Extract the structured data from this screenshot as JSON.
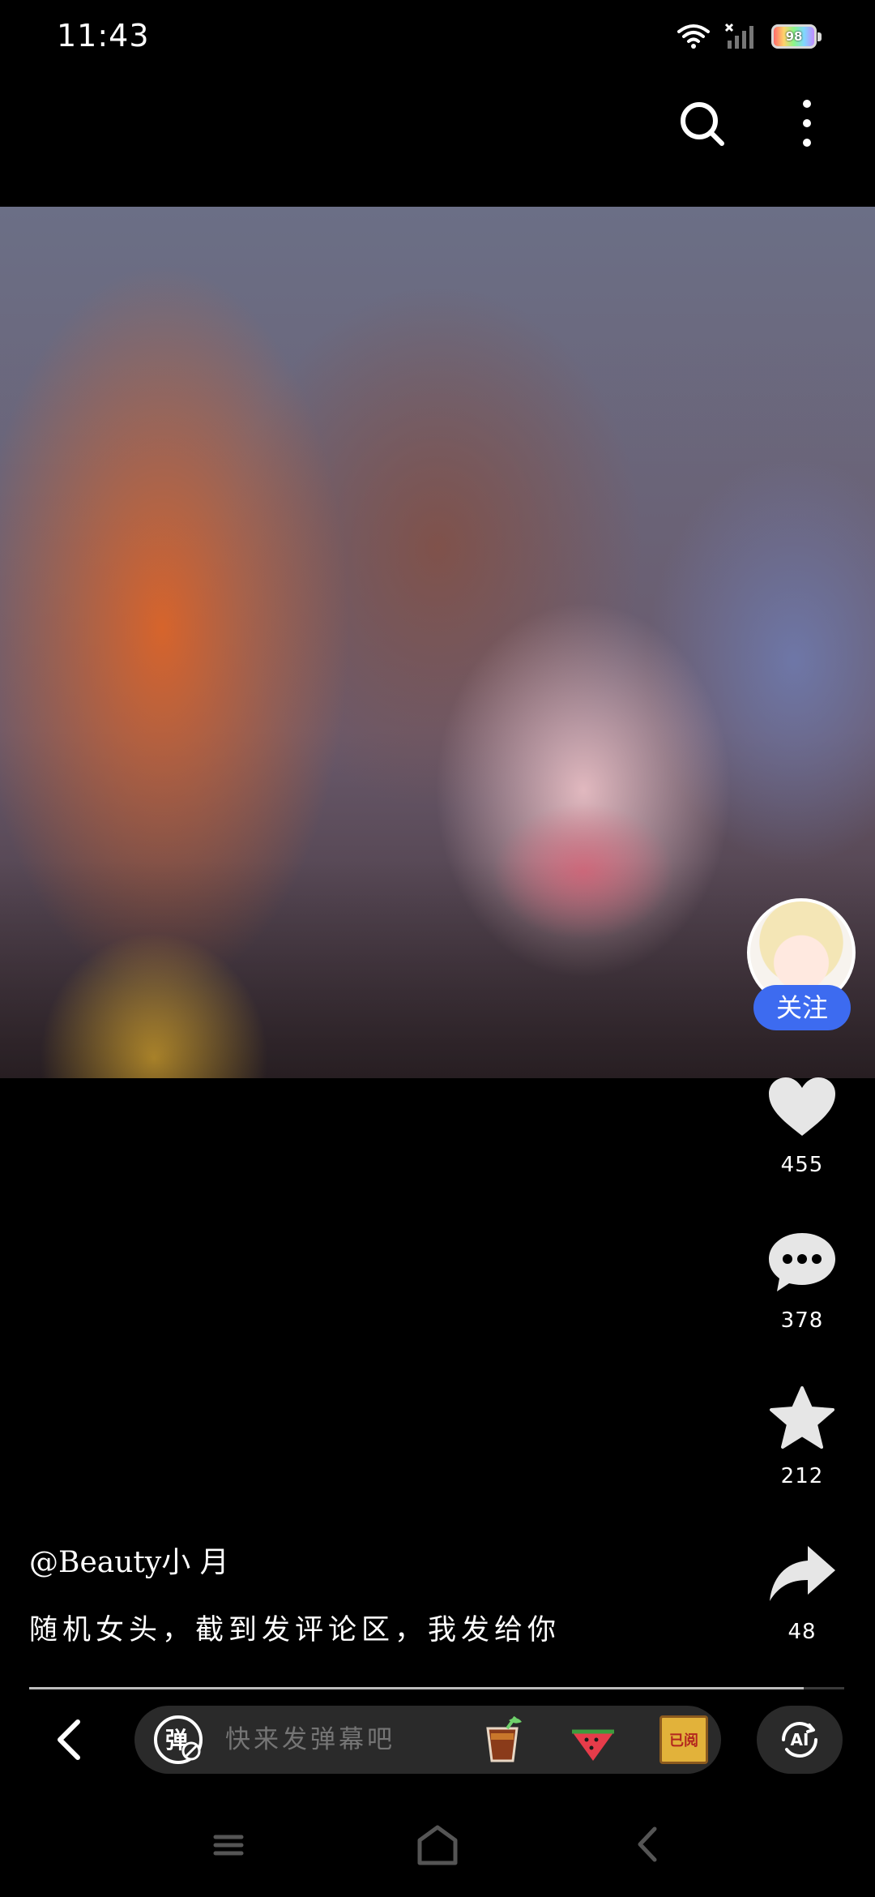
{
  "status_bar": {
    "time": "11:43",
    "battery": "98",
    "icons": [
      "wifi-icon",
      "cellular-no-signal-icon",
      "battery-icon"
    ]
  },
  "toolbar": {
    "icons": [
      "search-icon",
      "more-vertical-icon"
    ]
  },
  "video": {
    "description": "portrait video frame"
  },
  "creator": {
    "follow_label": "关注"
  },
  "actions": {
    "likes": "455",
    "comments": "378",
    "favorites": "212",
    "shares": "48"
  },
  "caption": {
    "author": "@Beauty小 月",
    "text": "随机女头，截到发评论区，我发给你"
  },
  "playback": {
    "progress": 0.95
  },
  "bottom_bar": {
    "danmaku_placeholder": "快来发弹幕吧",
    "read_sticker_label": "已阅"
  },
  "colors": {
    "accent": "#3d6bf0",
    "background": "#000000",
    "input_bg": "#2a2a2a"
  }
}
